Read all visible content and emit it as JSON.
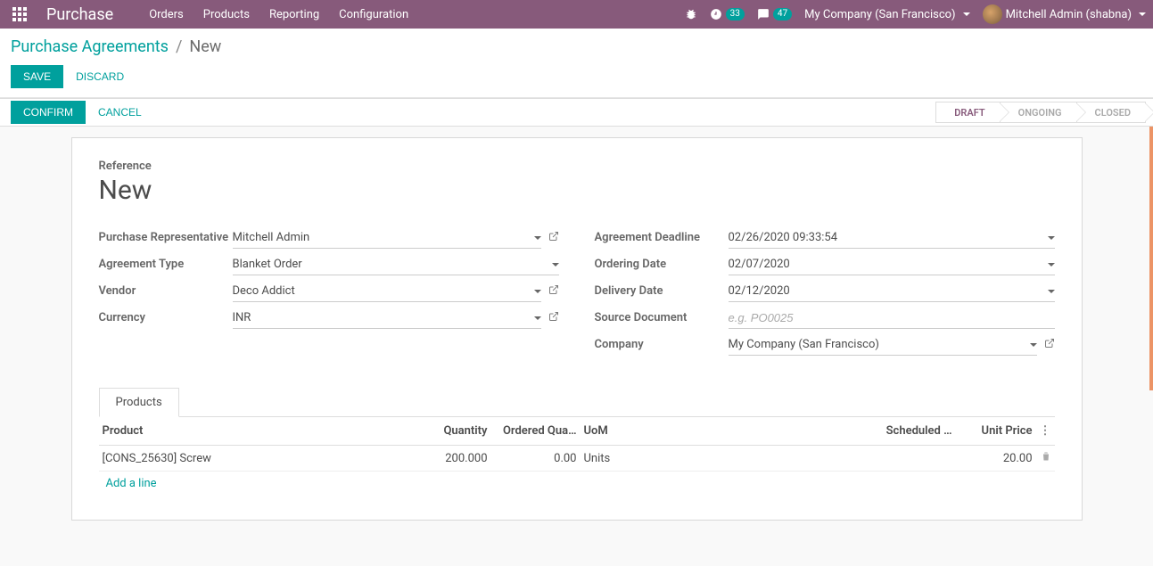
{
  "navbar": {
    "brand": "Purchase",
    "menu": [
      "Orders",
      "Products",
      "Reporting",
      "Configuration"
    ],
    "badge1": "33",
    "badge2": "47",
    "company": "My Company (San Francisco)",
    "user": "Mitchell Admin (shabna)"
  },
  "breadcrumb": {
    "parent": "Purchase Agreements",
    "current": "New"
  },
  "cp": {
    "save": "SAVE",
    "discard": "DISCARD"
  },
  "statusbar": {
    "confirm": "CONFIRM",
    "cancel": "CANCEL",
    "steps": [
      "DRAFT",
      "ONGOING",
      "CLOSED"
    ]
  },
  "form": {
    "reference_label": "Reference",
    "reference_value": "New",
    "left": {
      "rep_label": "Purchase Representative",
      "rep_value": "Mitchell Admin",
      "type_label": "Agreement Type",
      "type_value": "Blanket Order",
      "vendor_label": "Vendor",
      "vendor_value": "Deco Addict",
      "currency_label": "Currency",
      "currency_value": "INR"
    },
    "right": {
      "deadline_label": "Agreement Deadline",
      "deadline_value": "02/26/2020 09:33:54",
      "ordering_label": "Ordering Date",
      "ordering_value": "02/07/2020",
      "delivery_label": "Delivery Date",
      "delivery_value": "02/12/2020",
      "source_label": "Source Document",
      "source_placeholder": "e.g. PO0025",
      "company_label": "Company",
      "company_value": "My Company (San Francisco)"
    }
  },
  "tabs": {
    "products": "Products"
  },
  "table": {
    "headers": {
      "product": "Product",
      "quantity": "Quantity",
      "ordered": "Ordered Qua…",
      "uom": "UoM",
      "scheduled": "Scheduled …",
      "price": "Unit Price"
    },
    "rows": [
      {
        "product": "[CONS_25630] Screw",
        "quantity": "200.000",
        "ordered": "0.00",
        "uom": "Units",
        "scheduled": "",
        "price": "20.00"
      }
    ],
    "add": "Add a line"
  }
}
